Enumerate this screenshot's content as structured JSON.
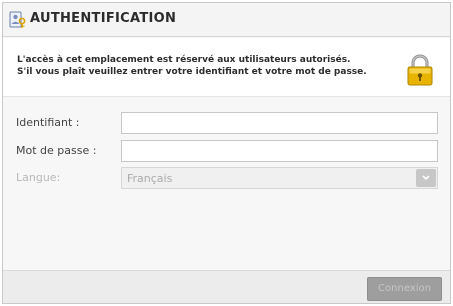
{
  "dialog": {
    "title": "AUTHENTIFICATION",
    "title_icon": "user-key-icon"
  },
  "notice": {
    "line1": "L'accès à cet emplacement est réservé aux utilisateurs autorisés.",
    "line2": "S'il vous plaît veuillez entrer votre identifiant et votre mot de passe.",
    "icon": "padlock-icon"
  },
  "form": {
    "identifiant_label": "Identifiant :",
    "identifiant_value": "",
    "password_label": "Mot de passe :",
    "password_value": "",
    "language_label": "Langue:",
    "language_value": "Français"
  },
  "footer": {
    "submit_label": "Connexion"
  },
  "colors": {
    "header_bg": "#f4f4f4",
    "panel_bg": "#f7f7f7",
    "button_disabled_bg": "#9e9e9e",
    "lock_gold": "#e8b400"
  }
}
